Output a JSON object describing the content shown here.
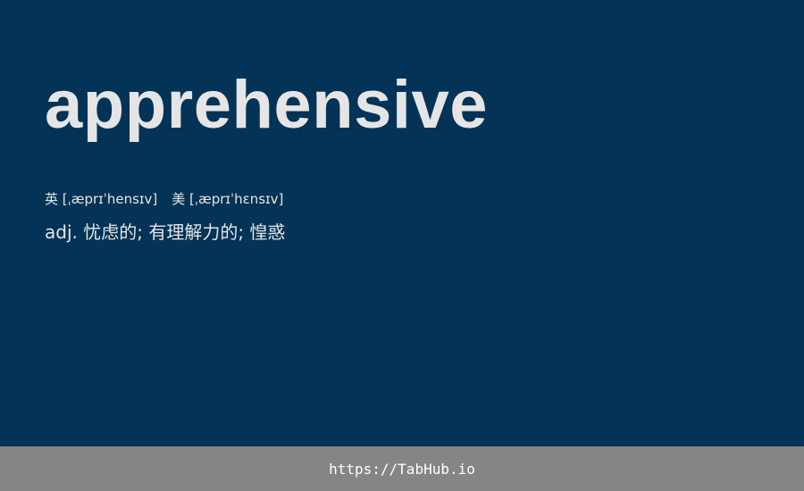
{
  "word": "apprehensive",
  "phonetic": {
    "uk": "英 [ˌæprɪˈhensɪv]",
    "us": "美 [ˌæprɪˈhɛnsɪv]"
  },
  "definition": "adj. 忧虑的; 有理解力的; 惶惑",
  "footer": {
    "link_text": "https://TabHub.io"
  },
  "colors": {
    "background": "#033356",
    "text": "#e5e5e5",
    "footer_background": "#858585",
    "footer_text": "#ffffff"
  }
}
